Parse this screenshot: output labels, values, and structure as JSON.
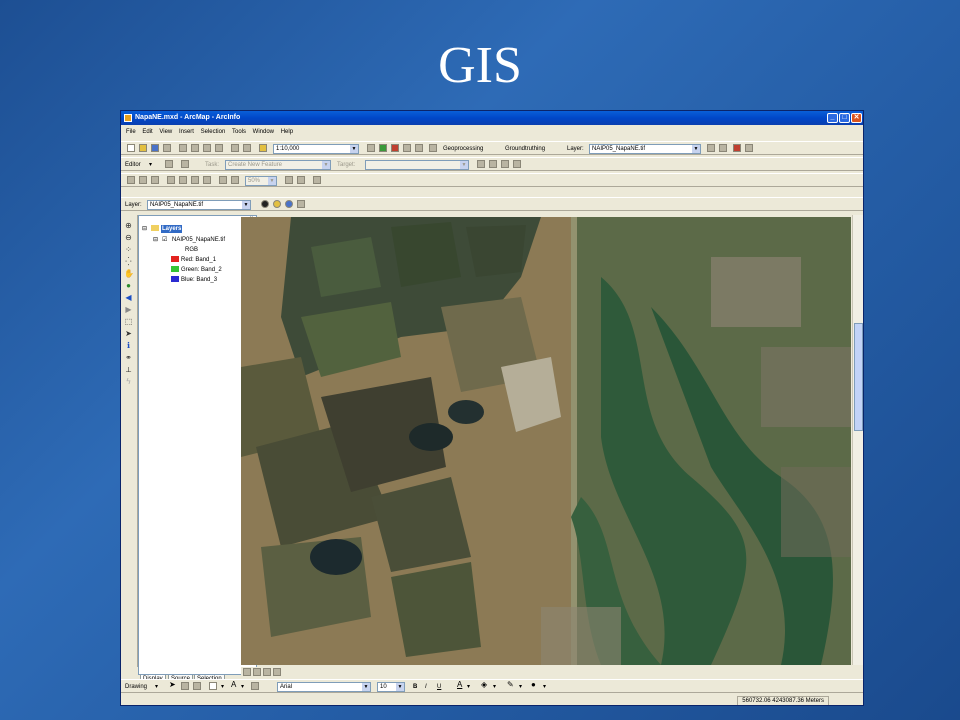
{
  "slide": {
    "title": "GIS"
  },
  "window": {
    "title": "NapaNE.mxd - ArcMap - ArcInfo",
    "controls": {
      "minimize": "_",
      "maximize": "□",
      "close": "✕"
    }
  },
  "menu": [
    "File",
    "Edit",
    "View",
    "Insert",
    "Selection",
    "Tools",
    "Window",
    "Help"
  ],
  "standard_toolbar": {
    "scale": "1:10,000",
    "geoprocessing": "Geoprocessing",
    "ground_truthing": "Groundtruthing",
    "layer_label": "Layer:",
    "layer_value": "NAIP05_NapaNE.tif"
  },
  "editor_toolbar": {
    "editor": "Editor",
    "task_label": "Task:",
    "task_value": "Create New Feature",
    "target_label": "Target:"
  },
  "georef_toolbar": {
    "zoom_value": "50%"
  },
  "effects_toolbar": {
    "layer_label": "Layer:",
    "layer_value": "NAIP05_NapaNE.tif"
  },
  "toc": {
    "root": "Layers",
    "layer": "NAIP05_NapaNE.tif",
    "composite": "RGB",
    "bands": [
      {
        "label": "Red:",
        "band": "Band_1",
        "color": "#e3231f"
      },
      {
        "label": "Green:",
        "band": "Band_2",
        "color": "#35c435"
      },
      {
        "label": "Blue:",
        "band": "Band_3",
        "color": "#2b2bd1"
      }
    ],
    "tabs": [
      "Display",
      "Source",
      "Selection"
    ]
  },
  "draw_toolbar": {
    "drawing": "Drawing",
    "font": "Arial",
    "size": "10",
    "bold": "B",
    "italic": "I",
    "underline": "U",
    "text_tool": "A"
  },
  "status": {
    "coordinates": "560732.06  4243087.36 Meters"
  }
}
